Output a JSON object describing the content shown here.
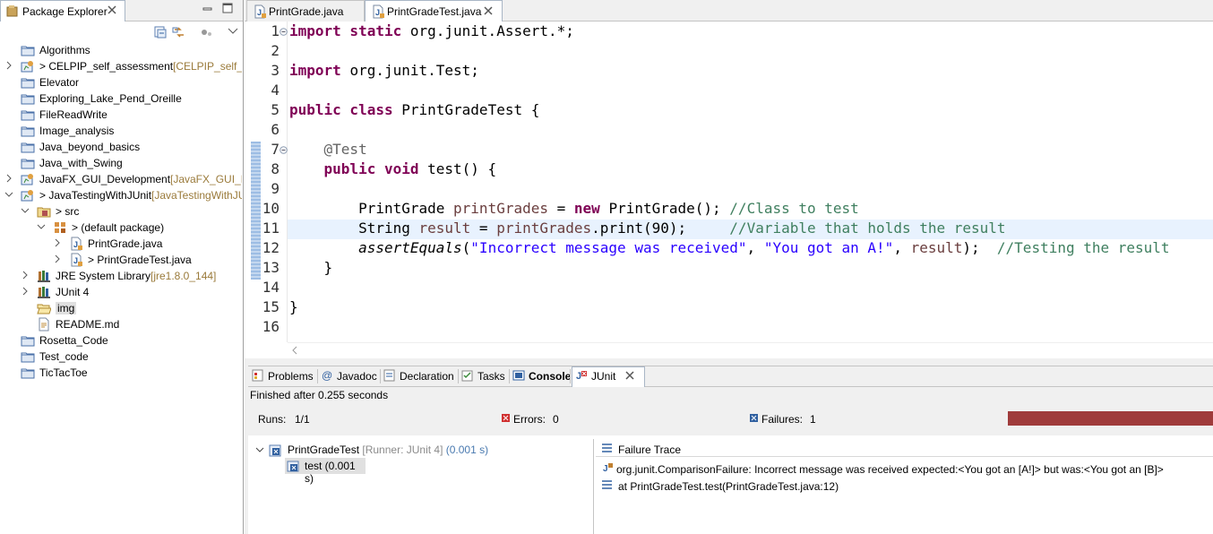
{
  "package_explorer": {
    "title": "Package Explorer",
    "items": [
      {
        "label": "Algorithms",
        "decor": "",
        "depth": 0,
        "icon": "folder-icon",
        "expand": "none"
      },
      {
        "label": "> CELPIP_self_assessment",
        "decor": " [CELPIP_self_ass",
        "depth": 0,
        "icon": "git-project-icon",
        "expand": "collapsed"
      },
      {
        "label": "Elevator",
        "decor": "",
        "depth": 0,
        "icon": "folder-icon",
        "expand": "none"
      },
      {
        "label": "Exploring_Lake_Pend_Oreille",
        "decor": "",
        "depth": 0,
        "icon": "folder-icon",
        "expand": "none"
      },
      {
        "label": "FileReadWrite",
        "decor": "",
        "depth": 0,
        "icon": "folder-icon",
        "expand": "none"
      },
      {
        "label": "Image_analysis",
        "decor": "",
        "depth": 0,
        "icon": "folder-icon",
        "expand": "none"
      },
      {
        "label": "Java_beyond_basics",
        "decor": "",
        "depth": 0,
        "icon": "folder-icon",
        "expand": "none"
      },
      {
        "label": "Java_with_Swing",
        "decor": "",
        "depth": 0,
        "icon": "folder-icon",
        "expand": "none"
      },
      {
        "label": "JavaFX_GUI_Development",
        "decor": " [JavaFX_GUI_Dev",
        "depth": 0,
        "icon": "git-project-icon",
        "expand": "collapsed"
      },
      {
        "label": "> JavaTestingWithJUnit",
        "decor": " [JavaTestingWithJU",
        "depth": 0,
        "icon": "git-project-icon",
        "expand": "expanded"
      },
      {
        "label": "> src",
        "decor": "",
        "depth": 1,
        "icon": "source-folder-icon",
        "expand": "expanded"
      },
      {
        "label": "> (default package)",
        "decor": "",
        "depth": 2,
        "icon": "package-icon",
        "expand": "expanded"
      },
      {
        "label": "PrintGrade.java",
        "decor": "",
        "depth": 3,
        "icon": "java-file-icon",
        "expand": "collapsed"
      },
      {
        "label": "> PrintGradeTest.java",
        "decor": "",
        "depth": 3,
        "icon": "java-file-icon",
        "expand": "collapsed"
      },
      {
        "label": "JRE System Library",
        "decor": " [jre1.8.0_144]",
        "depth": 1,
        "icon": "library-icon",
        "expand": "collapsed"
      },
      {
        "label": "JUnit 4",
        "decor": "",
        "depth": 1,
        "icon": "library-icon",
        "expand": "collapsed"
      },
      {
        "label": "img",
        "decor": "",
        "depth": 1,
        "icon": "open-folder-icon",
        "expand": "none",
        "selected": true
      },
      {
        "label": "README.md",
        "decor": "",
        "depth": 1,
        "icon": "text-file-icon",
        "expand": "none"
      },
      {
        "label": "Rosetta_Code",
        "decor": "",
        "depth": 0,
        "icon": "folder-icon",
        "expand": "none"
      },
      {
        "label": "Test_code",
        "decor": "",
        "depth": 0,
        "icon": "folder-icon",
        "expand": "none"
      },
      {
        "label": "TicTacToe",
        "decor": "",
        "depth": 0,
        "icon": "folder-icon",
        "expand": "none"
      }
    ]
  },
  "editor": {
    "tabs": [
      {
        "label": "PrintGrade.java",
        "active": false
      },
      {
        "label": "PrintGradeTest.java",
        "active": true
      }
    ],
    "line_numbers": [
      "1",
      "2",
      "3",
      "4",
      "5",
      "6",
      "7",
      "8",
      "9",
      "10",
      "11",
      "12",
      "13",
      "14",
      "15",
      "16"
    ],
    "lines": [
      [
        [
          "kw",
          "import static "
        ],
        [
          "",
          "org.junit.Assert.*;"
        ]
      ],
      [],
      [
        [
          "kw",
          "import "
        ],
        [
          "",
          "org.junit.Test;"
        ]
      ],
      [],
      [
        [
          "kw",
          "public class "
        ],
        [
          "",
          "PrintGradeTest {"
        ]
      ],
      [],
      [
        [
          "",
          "    "
        ],
        [
          "ann",
          "@Test"
        ]
      ],
      [
        [
          "",
          "    "
        ],
        [
          "kw",
          "public void "
        ],
        [
          "",
          "test() {"
        ]
      ],
      [],
      [
        [
          "",
          "        PrintGrade "
        ],
        [
          "fld",
          "printGrades"
        ],
        [
          "",
          " = "
        ],
        [
          "kw",
          "new "
        ],
        [
          "",
          "PrintGrade(); "
        ],
        [
          "cm",
          "//Class to test"
        ]
      ],
      [
        [
          "",
          "        String "
        ],
        [
          "fld",
          "result"
        ],
        [
          "",
          " = "
        ],
        [
          "fld",
          "printGrades"
        ],
        [
          "",
          ".print(90);     "
        ],
        [
          "cm",
          "//Variable that holds the result"
        ]
      ],
      [
        [
          "",
          "        "
        ],
        [
          "it",
          "assertEquals"
        ],
        [
          "",
          "("
        ],
        [
          "str",
          "\"Incorrect message was received\""
        ],
        [
          "",
          ", "
        ],
        [
          "str",
          "\"You got an A!\""
        ],
        [
          "",
          ", "
        ],
        [
          "fld",
          "result"
        ],
        [
          "",
          ");  "
        ],
        [
          "cm",
          "//Testing the result"
        ]
      ],
      [
        [
          "",
          "    }"
        ]
      ],
      [],
      [
        [
          "",
          "}"
        ]
      ],
      []
    ]
  },
  "bottom_panel": {
    "tabs": [
      "Problems",
      "Javadoc",
      "Declaration",
      "Tasks",
      "Console",
      "JUnit"
    ],
    "status": "Finished after 0.255 seconds",
    "runs_label": "Runs:",
    "runs_value": "1/1",
    "errors_label": "Errors:",
    "errors_value": "0",
    "failures_label": "Failures:",
    "failures_value": "1",
    "progress_color": "#9f3b3b",
    "test_root": "PrintGradeTest",
    "test_root_runner": " [Runner: JUnit 4]",
    "test_root_time": " (0.001 s)",
    "test_case": "test (0.001 s)",
    "failure_trace_title": "Failure Trace",
    "trace_lines": [
      "org.junit.ComparisonFailure: Incorrect message was received expected:<You got an [A!]> but was:<You got an [B]>",
      "at PrintGradeTest.test(PrintGradeTest.java:12)"
    ]
  }
}
